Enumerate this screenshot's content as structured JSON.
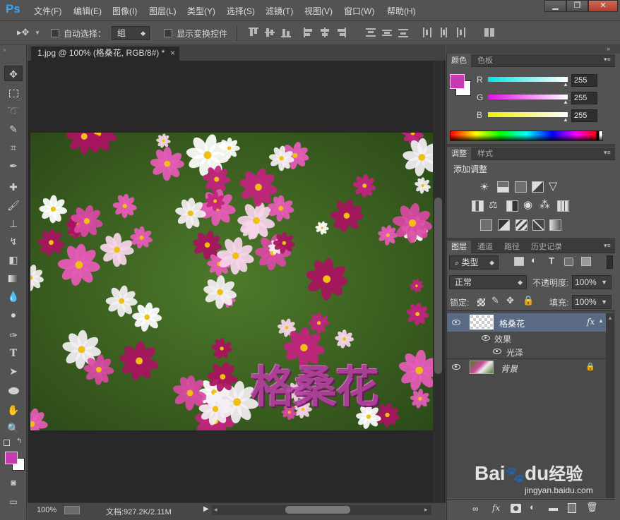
{
  "app": {
    "logo": "Ps"
  },
  "menu": [
    "文件(F)",
    "编辑(E)",
    "图像(I)",
    "图层(L)",
    "类型(Y)",
    "选择(S)",
    "滤镜(T)",
    "视图(V)",
    "窗口(W)",
    "帮助(H)"
  ],
  "window_buttons": {
    "minimize": "▁",
    "restore": "❐",
    "close": "✕"
  },
  "options_bar": {
    "auto_select_label": "自动选择：",
    "auto_select_value": "组",
    "show_transform_label": "显示变换控件"
  },
  "document": {
    "tab_title": "1.jpg @ 100% (格桑花, RGB/8#) *",
    "tab_close": "×",
    "text_layer_overlay": "格桑花"
  },
  "status": {
    "zoom": "100%",
    "doc_info": "文档:927.2K/2.11M"
  },
  "color_panel": {
    "tabs": [
      "颜色",
      "色板"
    ],
    "active_tab": "颜色",
    "channels": [
      {
        "label": "R",
        "value": "255",
        "gradient_color": "#00e5e5"
      },
      {
        "label": "G",
        "value": "255",
        "gradient_color": "#e010e0"
      },
      {
        "label": "B",
        "value": "255",
        "gradient_color": "#f0f000"
      }
    ],
    "foreground_color": "#c83aaf",
    "background_color": "#ffffff"
  },
  "adjustments_panel": {
    "tabs": [
      "调整",
      "样式"
    ],
    "active_tab": "调整",
    "title": "添加调整"
  },
  "layers_panel": {
    "tabs": [
      "图层",
      "通道",
      "路径",
      "历史记录"
    ],
    "active_tab": "图层",
    "filter_type": "类型",
    "blend_mode": "正常",
    "opacity_label": "不透明度:",
    "opacity_value": "100%",
    "lock_label": "锁定:",
    "fill_label": "填充:",
    "fill_value": "100%",
    "layers": [
      {
        "name": "格桑花",
        "fx": "fx",
        "effects_label": "效果",
        "effect_items": [
          "光泽"
        ]
      },
      {
        "name": "背景"
      }
    ]
  },
  "watermark": {
    "brand": "Bai",
    "brand2": "du",
    "suffix": "经验",
    "url": "jingyan.baidu.com"
  },
  "colors": {
    "ui_bg": "#535353",
    "canvas_bg": "#282828",
    "accent_blue": "#2fa7ff",
    "selected_layer": "#5a6a84"
  }
}
